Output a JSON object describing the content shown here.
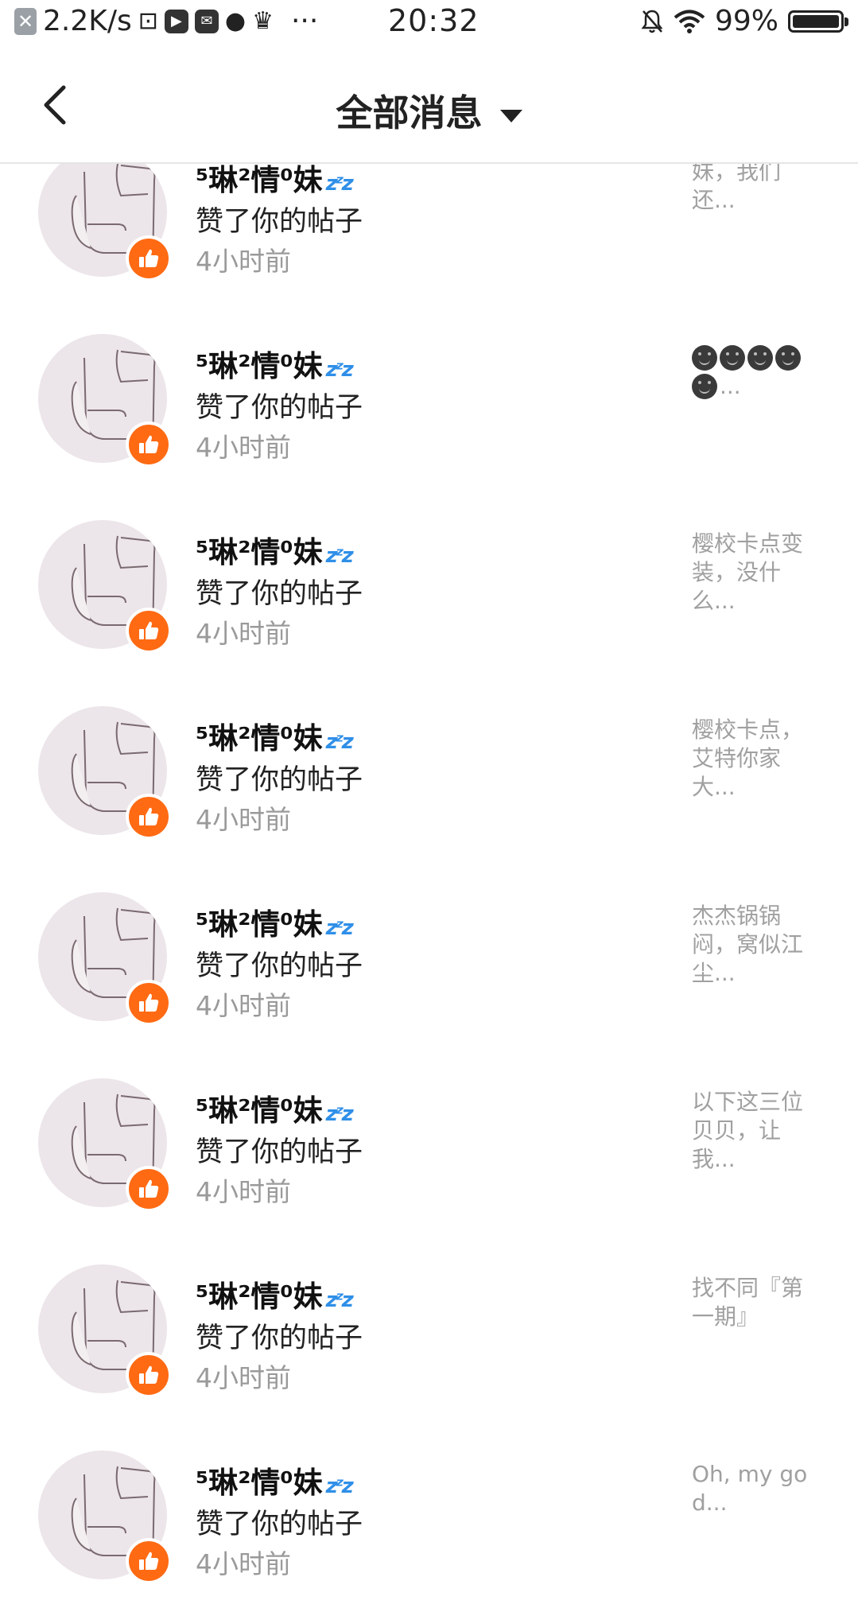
{
  "status_bar": {
    "net_speed": "2.2K/s",
    "time": "20:32",
    "battery": "99%",
    "more": "···"
  },
  "header": {
    "title": "全部消息"
  },
  "messages": [
    {
      "name": "⁵琳²情⁰妹",
      "action": "赞了你的帖子",
      "time": "4小时前",
      "preview": "妹，我们还..."
    },
    {
      "name": "⁵琳²情⁰妹",
      "action": "赞了你的帖子",
      "time": "4小时前",
      "preview": "...",
      "preview_emoji_count": 5
    },
    {
      "name": "⁵琳²情⁰妹",
      "action": "赞了你的帖子",
      "time": "4小时前",
      "preview": "樱校卡点变装，没什么..."
    },
    {
      "name": "⁵琳²情⁰妹",
      "action": "赞了你的帖子",
      "time": "4小时前",
      "preview": "樱校卡点，艾特你家大..."
    },
    {
      "name": "⁵琳²情⁰妹",
      "action": "赞了你的帖子",
      "time": "4小时前",
      "preview": "杰杰锅锅闷，窝似江尘..."
    },
    {
      "name": "⁵琳²情⁰妹",
      "action": "赞了你的帖子",
      "time": "4小时前",
      "preview": "以下这三位贝贝，让我..."
    },
    {
      "name": "⁵琳²情⁰妹",
      "action": "赞了你的帖子",
      "time": "4小时前",
      "preview": "找不同『第一期』"
    },
    {
      "name": "⁵琳²情⁰妹",
      "action": "赞了你的帖子",
      "time": "4小时前",
      "preview": "Oh, my god..."
    }
  ],
  "colors": {
    "like_badge": "#ff6a13",
    "zzz": "#2f8fe8"
  }
}
